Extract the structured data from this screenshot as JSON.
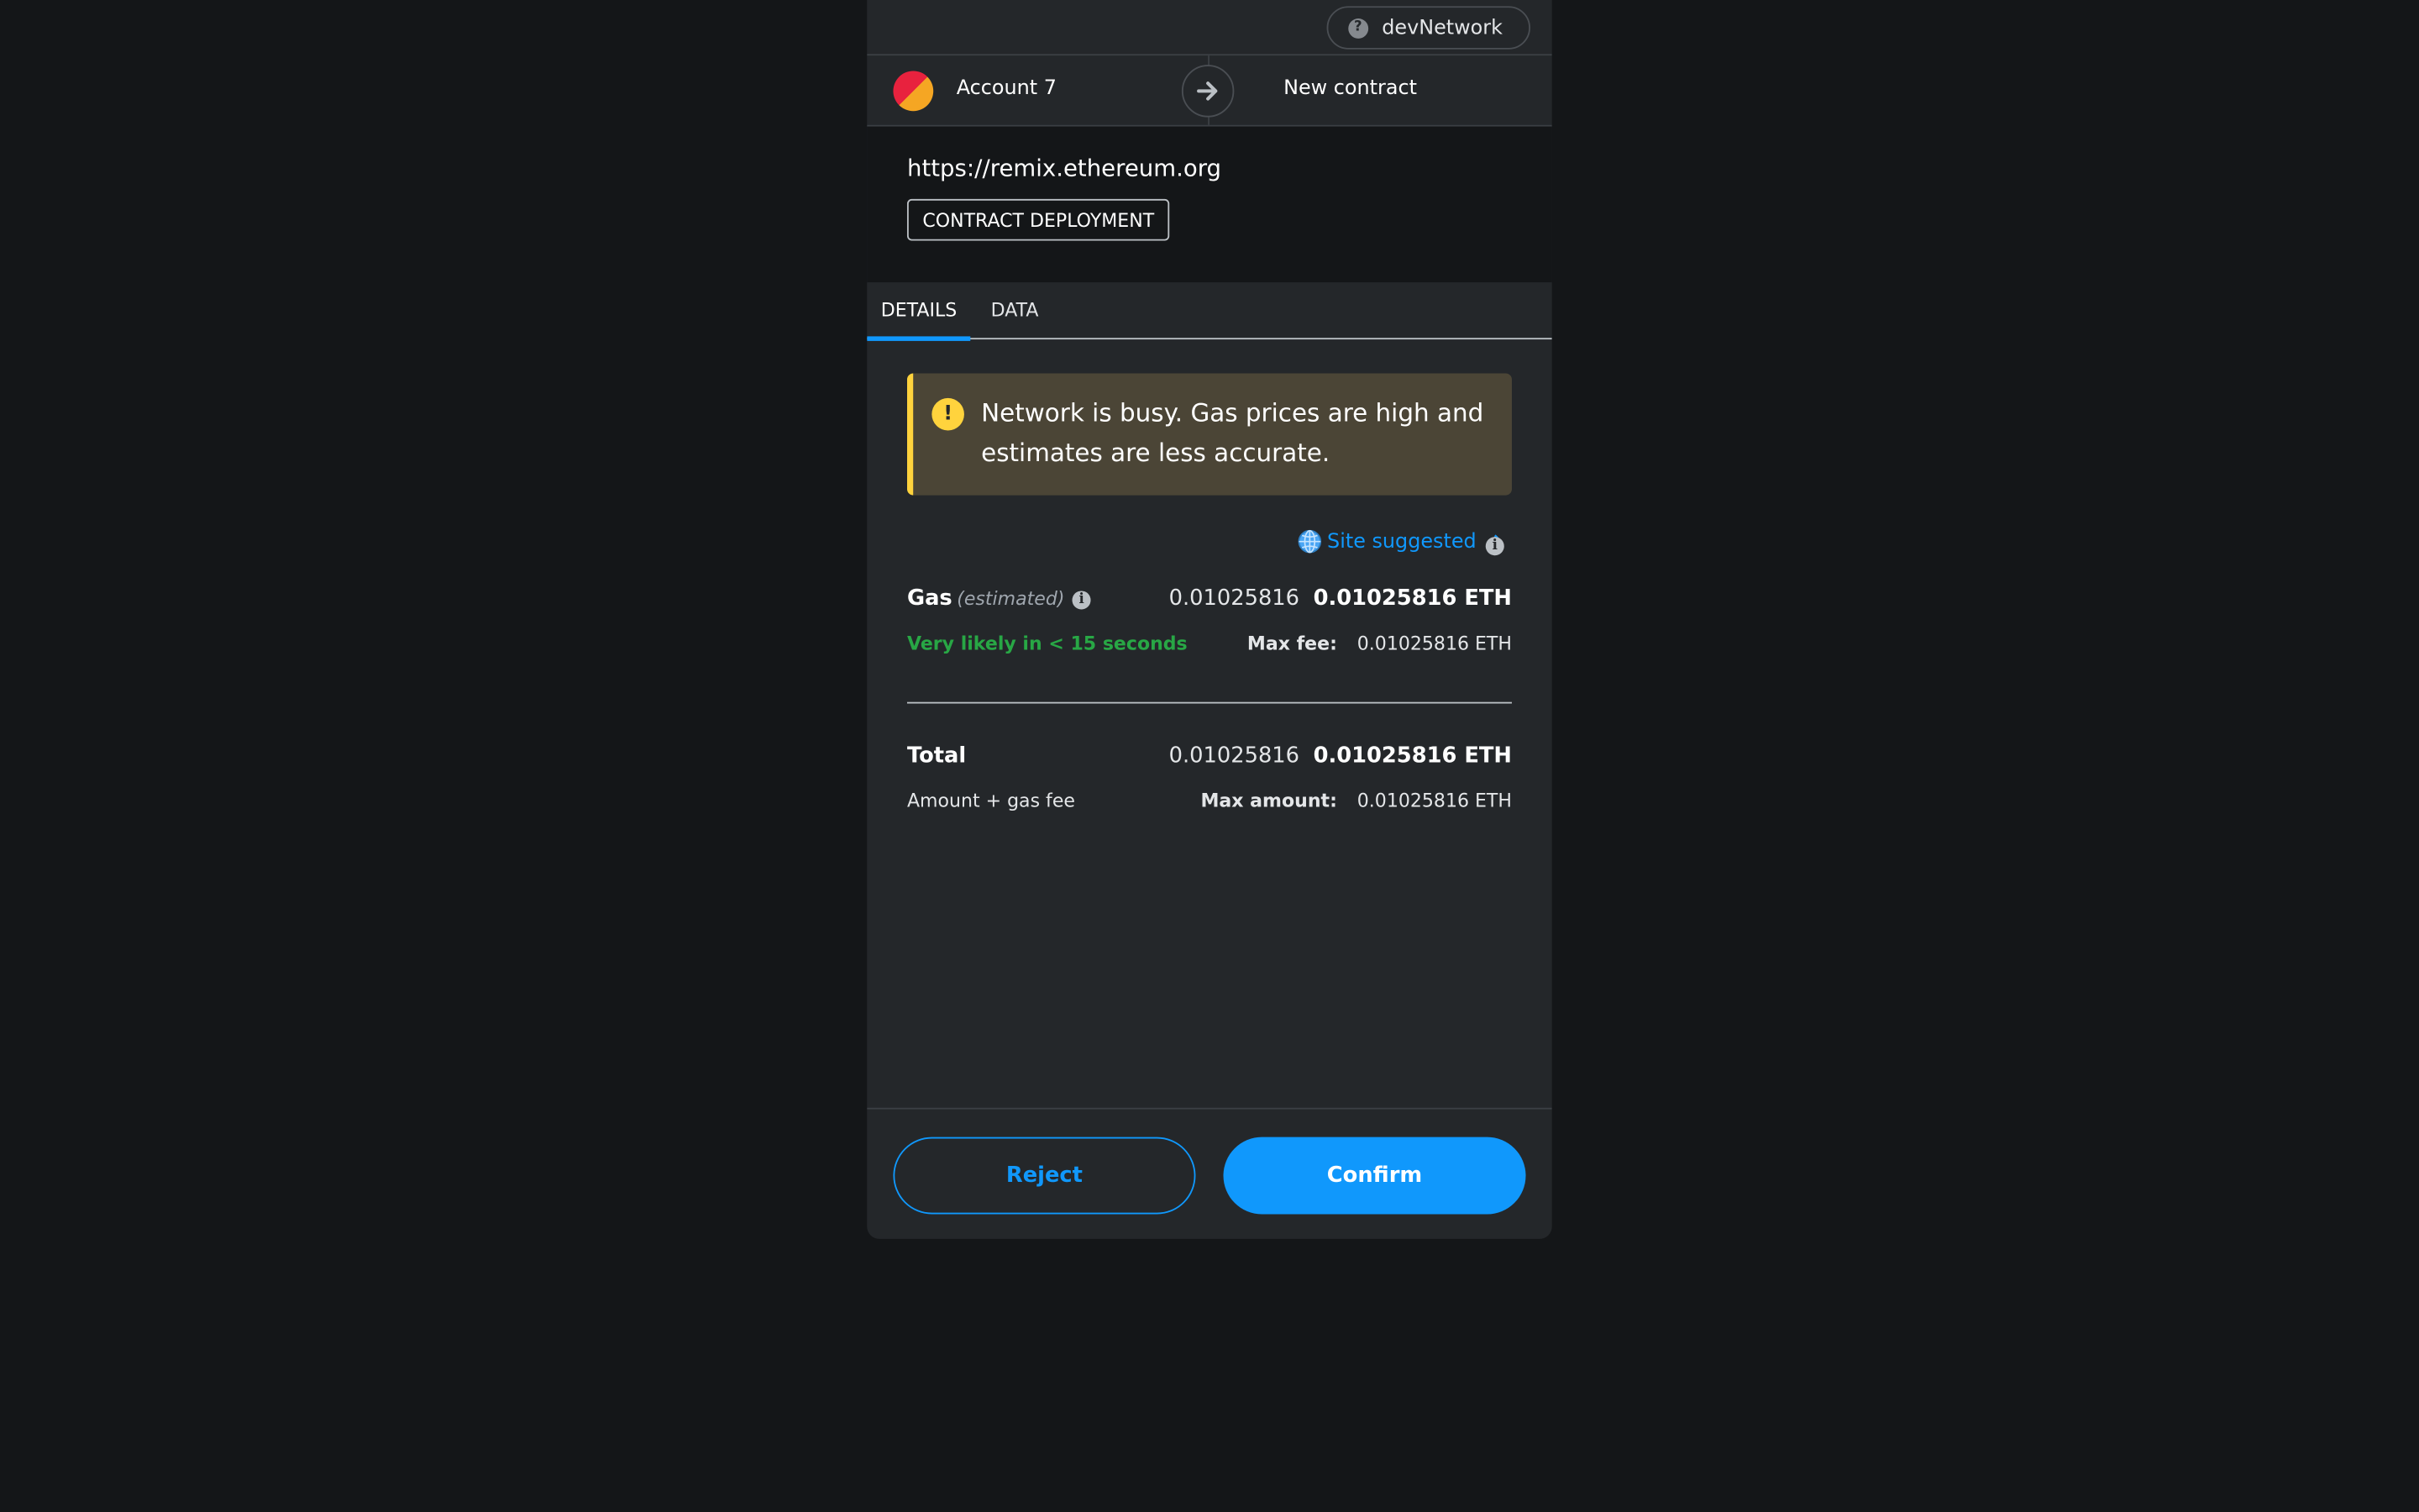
{
  "network": {
    "name": "devNetwork",
    "icon": "question-icon"
  },
  "account": {
    "name": "Account 7",
    "recipient": "New contract"
  },
  "origin": {
    "url": "https://remix.ethereum.org",
    "badge": "CONTRACT DEPLOYMENT"
  },
  "tabs": [
    {
      "label": "DETAILS",
      "active": true
    },
    {
      "label": "DATA",
      "active": false
    }
  ],
  "warning": {
    "text": "Network is busy. Gas prices are high and estimates are less accurate.",
    "icon": "exclamation-icon"
  },
  "gas_suggestion": {
    "label": "Site suggested"
  },
  "gas": {
    "label": "Gas",
    "estimated": "(estimated)",
    "secondary_value": "0.01025816",
    "primary_value": "0.01025816 ETH",
    "likely_text": "Very likely in < 15 seconds",
    "max_fee_label": "Max fee:",
    "max_fee_value": "0.01025816 ETH"
  },
  "total": {
    "label": "Total",
    "secondary_value": "0.01025816",
    "primary_value": "0.01025816 ETH",
    "sublabel": "Amount + gas fee",
    "max_amount_label": "Max amount:",
    "max_amount_value": "0.01025816 ETH"
  },
  "buttons": {
    "reject": "Reject",
    "confirm": "Confirm"
  },
  "colors": {
    "accent": "#1098fc",
    "warning": "#ffd33d",
    "success": "#28a745",
    "background": "#24272a"
  }
}
